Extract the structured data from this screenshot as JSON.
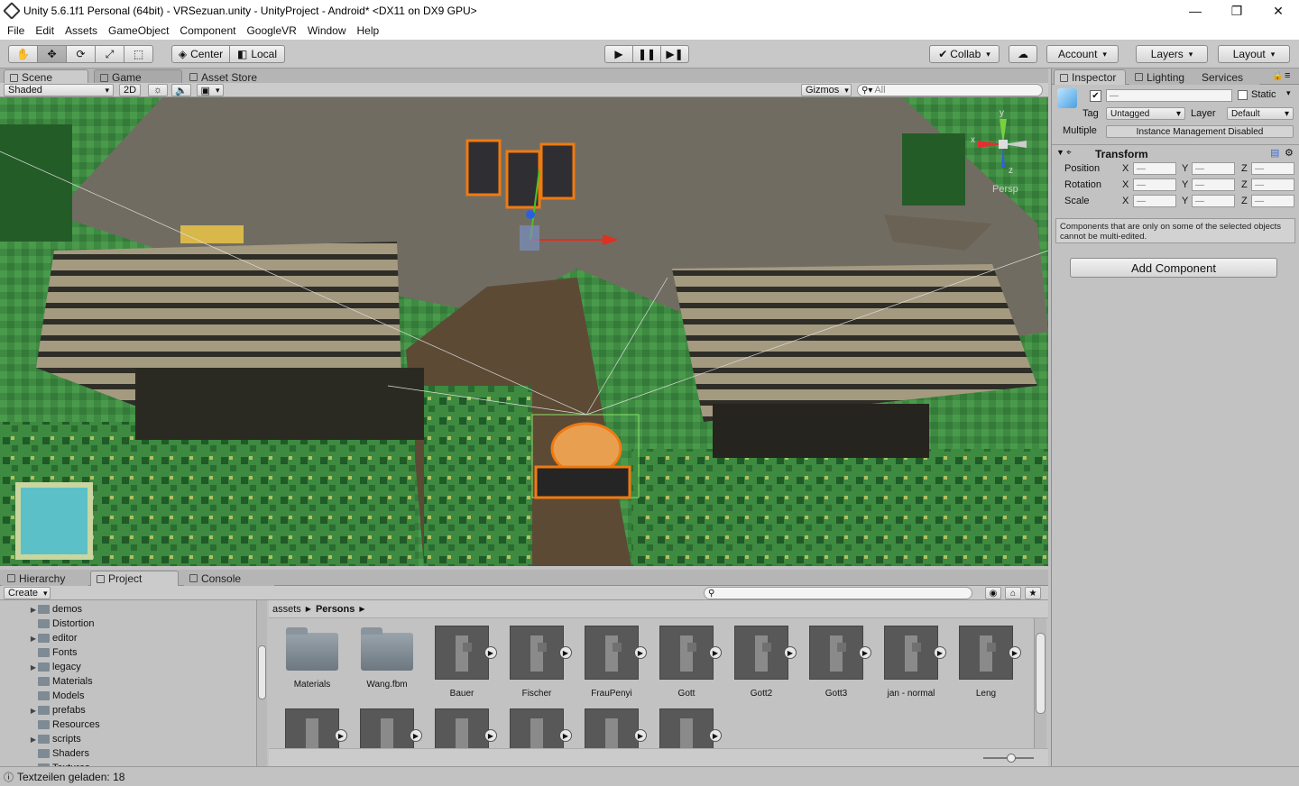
{
  "titlebar": {
    "title": "Unity 5.6.1f1 Personal (64bit) - VRSezuan.unity - UnityProject - Android* <DX11 on DX9 GPU>",
    "minimize": "—",
    "maximize": "❐",
    "close": "✕"
  },
  "menu": [
    "File",
    "Edit",
    "Assets",
    "GameObject",
    "Component",
    "GoogleVR",
    "Window",
    "Help"
  ],
  "toolbar": {
    "pivot": "Center",
    "space": "Local",
    "collab": "Collab",
    "account": "Account",
    "layers": "Layers",
    "layout": "Layout"
  },
  "scene_tabs": {
    "scene": "Scene",
    "game": "Game",
    "store": "Asset Store"
  },
  "scene_bar": {
    "shading": "Shaded",
    "mode2d": "2D",
    "gizmos": "Gizmos",
    "search_placeholder": "All"
  },
  "gizmo": {
    "persp": "Persp",
    "y": "y",
    "x": "x",
    "z": "z"
  },
  "inspector": {
    "tabs": [
      "Inspector",
      "Lighting",
      "Services"
    ],
    "name_value": "—",
    "static_label": "Static",
    "tag_label": "Tag",
    "tag_value": "Untagged",
    "layer_label": "Layer",
    "layer_value": "Default",
    "multiple_label": "Multiple",
    "multiple_value": "Instance Management Disabled",
    "transform_title": "Transform",
    "rows": [
      {
        "label": "Position"
      },
      {
        "label": "Rotation"
      },
      {
        "label": "Scale"
      }
    ],
    "axes": [
      "X",
      "Y",
      "Z"
    ],
    "dash": "—",
    "note": "Components that are only on some of the selected objects cannot be multi-edited.",
    "add_component": "Add Component"
  },
  "bottom_tabs": {
    "hierarchy": "Hierarchy",
    "project": "Project",
    "console": "Console"
  },
  "project": {
    "create": "Create",
    "tree": [
      {
        "name": "demos",
        "arrow": true
      },
      {
        "name": "Distortion",
        "arrow": false
      },
      {
        "name": "editor",
        "arrow": true
      },
      {
        "name": "Fonts",
        "arrow": false
      },
      {
        "name": "legacy",
        "arrow": true
      },
      {
        "name": "Materials",
        "arrow": false
      },
      {
        "name": "Models",
        "arrow": false
      },
      {
        "name": "prefabs",
        "arrow": true
      },
      {
        "name": "Resources",
        "arrow": false
      },
      {
        "name": "scripts",
        "arrow": true
      },
      {
        "name": "Shaders",
        "arrow": false
      },
      {
        "name": "Textures",
        "arrow": false
      }
    ],
    "breadcrumb": [
      "assets",
      "Persons"
    ],
    "assets_row1": [
      "Materials",
      "Wang.fbm",
      "Bauer",
      "Fischer",
      "FrauPenyi",
      "Gott",
      "Gott2",
      "Gott3",
      "jan - normal",
      "Leng"
    ]
  },
  "status": {
    "text": "Textzeilen geladen: 18"
  },
  "colors": {
    "selection": "#f07a10",
    "accent": "#3a6fd8"
  }
}
